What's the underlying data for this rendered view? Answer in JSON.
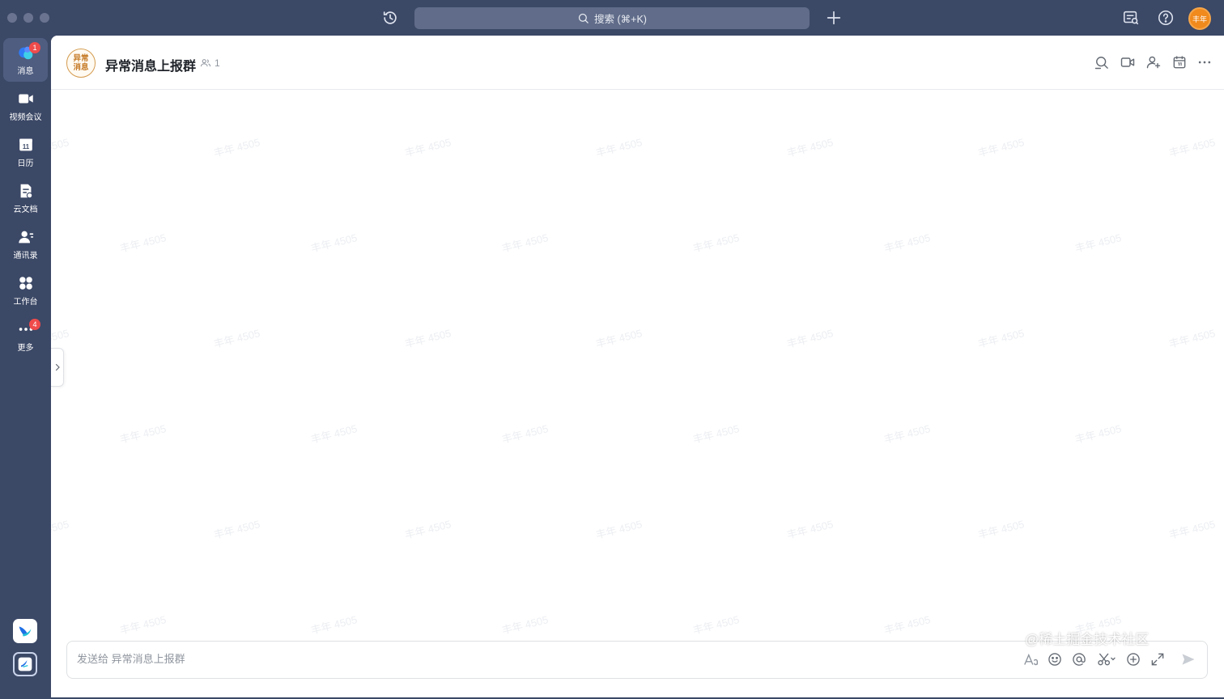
{
  "titlebar": {
    "search_placeholder": "搜索 (⌘+K)",
    "user_avatar_text": "丰年",
    "icons": [
      "history-icon",
      "search-icon",
      "plus-icon",
      "notification-panel-icon",
      "help-icon"
    ]
  },
  "sidebar": {
    "items": [
      {
        "label": "消息",
        "icon": "chat-bubbles-icon",
        "badge": "1",
        "active": true
      },
      {
        "label": "视频会议",
        "icon": "video-camera-icon"
      },
      {
        "label": "日历",
        "icon": "calendar-icon",
        "day": "11"
      },
      {
        "label": "云文档",
        "icon": "document-icon"
      },
      {
        "label": "通讯录",
        "icon": "contacts-icon"
      },
      {
        "label": "工作台",
        "icon": "grid-apps-icon"
      },
      {
        "label": "更多",
        "icon": "more-dots-icon",
        "badge": "4"
      }
    ]
  },
  "chat": {
    "avatar_text": "异常消息",
    "title": "异常消息上报群",
    "member_count": "1",
    "watermark": "丰年 4505"
  },
  "composer": {
    "placeholder": "发送给 异常消息上报群"
  },
  "overlay": {
    "site_watermark": "@稀土掘金技术社区"
  },
  "colors": {
    "chrome": "#3b4866",
    "active_nav": "#4f5d80",
    "badge": "#f04b4b",
    "avatar_orange": "#f08a1c"
  }
}
